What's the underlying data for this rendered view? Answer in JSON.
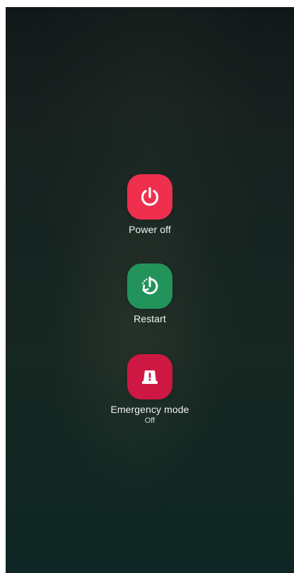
{
  "power_menu": {
    "items": [
      {
        "label": "Power off",
        "icon": "power-icon",
        "color": "#ef2f4e"
      },
      {
        "label": "Restart",
        "icon": "restart-icon",
        "color": "#22945b"
      },
      {
        "label": "Emergency mode",
        "sublabel": "Off",
        "icon": "emergency-icon",
        "color": "#cf1743"
      }
    ]
  }
}
